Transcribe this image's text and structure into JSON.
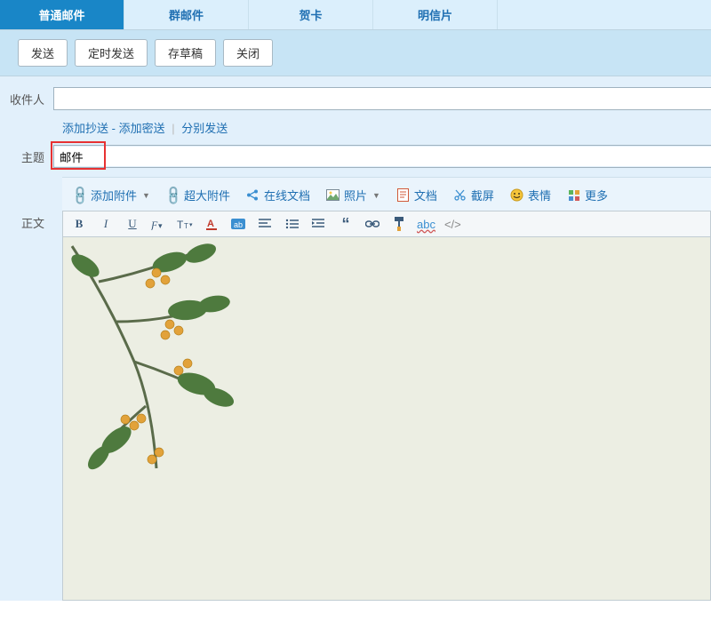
{
  "tabs": [
    {
      "label": "普通邮件",
      "active": true
    },
    {
      "label": "群邮件",
      "active": false
    },
    {
      "label": "贺卡",
      "active": false
    },
    {
      "label": "明信片",
      "active": false
    }
  ],
  "actions": {
    "send": "发送",
    "schedule": "定时发送",
    "draft": "存草稿",
    "close": "关闭"
  },
  "labels": {
    "recipient": "收件人",
    "subject": "主题",
    "body": "正文"
  },
  "cc_links": {
    "add_cc": "添加抄送",
    "add_bcc": "添加密送",
    "send_sep": "分别发送"
  },
  "fields": {
    "recipient_value": "",
    "subject_value": "邮件"
  },
  "attach_bar": {
    "add_attachment": "添加附件",
    "big_attachment": "超大附件",
    "online_doc": "在线文档",
    "photo": "照片",
    "doc": "文档",
    "screenshot": "截屏",
    "emoji": "表情",
    "more": "更多"
  },
  "toolbar": {
    "abc": "abc",
    "code": "</>"
  }
}
